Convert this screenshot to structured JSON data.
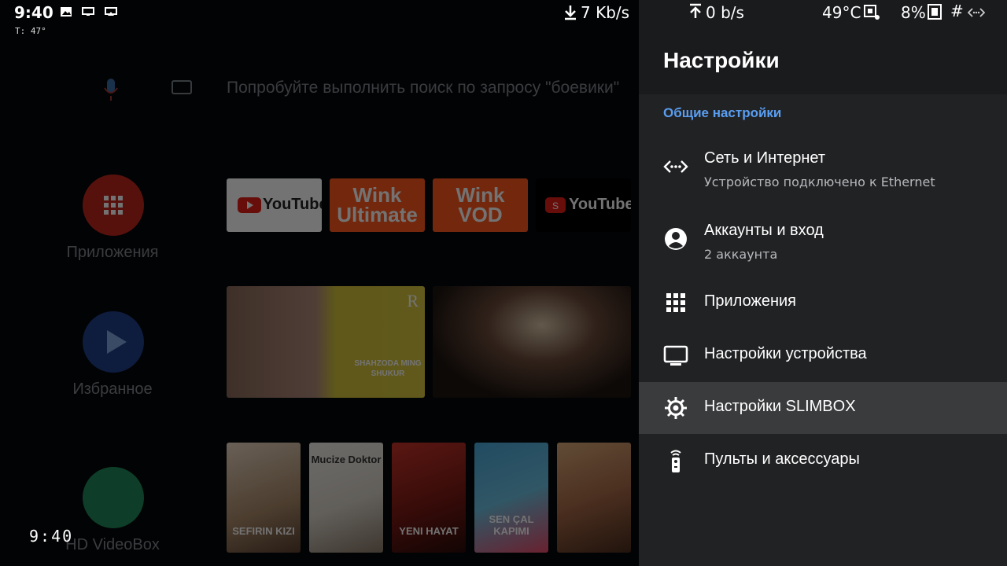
{
  "status_bar": {
    "time": "9:40",
    "temp_small": "T: 47°",
    "download_speed": "7 Kb/s",
    "upload_speed": "0 b/s",
    "cpu_temp": "49°C",
    "cpu_load": "8%",
    "hash": "#"
  },
  "launcher": {
    "search_placeholder": "Попробуйте выполнить поиск по запросу \"боевики\"",
    "sidebar": [
      {
        "label": "Приложения",
        "color": "#c0271e"
      },
      {
        "label": "Избранное",
        "color": "#1f3f8a"
      },
      {
        "label": "HD VideoBox",
        "color": "#1f8a5b"
      }
    ],
    "apps": [
      {
        "label": "YouTube",
        "color": "#ffffff"
      },
      {
        "label": "Wink Ultimate",
        "color": "#ff5a1f"
      },
      {
        "label": "Wink VOD",
        "color": "#ff5a1f"
      },
      {
        "label": "YouTube",
        "color": "#000000"
      }
    ],
    "previews": [
      {
        "title": "SHAHZODA MING SHUKUR"
      },
      {
        "title": ""
      }
    ],
    "posters": [
      {
        "title": "SEFIRIN KIZI"
      },
      {
        "title": "Mucize Doktor"
      },
      {
        "title": "YENI HAYAT"
      },
      {
        "title": "SEN ÇAL KAPIMI"
      },
      {
        "title": ""
      }
    ],
    "clock": "9:40"
  },
  "settings": {
    "title": "Настройки",
    "section": "Общие настройки",
    "items": [
      {
        "label": "Сеть и Интернет",
        "sub": "Устройство подключено к Ethernet",
        "icon": "network-icon"
      },
      {
        "label": "Аккаунты и вход",
        "sub": "2 аккаунта",
        "icon": "account-icon"
      },
      {
        "label": "Приложения",
        "sub": "",
        "icon": "apps-grid-icon"
      },
      {
        "label": "Настройки устройства",
        "sub": "",
        "icon": "tv-icon"
      },
      {
        "label": "Настройки SLIMBOX",
        "sub": "",
        "icon": "gear-icon"
      },
      {
        "label": "Пульты и аксессуары",
        "sub": "",
        "icon": "remote-icon"
      }
    ]
  },
  "colors": {
    "accent": "#5a9ef1",
    "panel_bg": "#212224",
    "selected_bg": "#3a3b3d"
  }
}
